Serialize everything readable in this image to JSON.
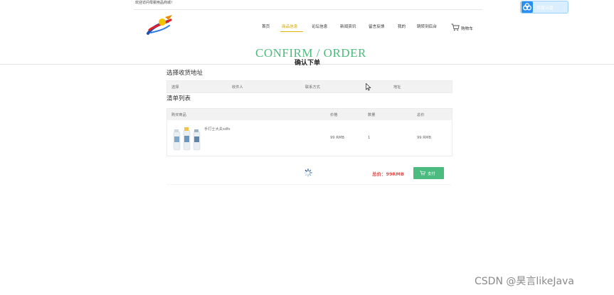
{
  "topbar": {
    "welcome": "欢迎访问母婴用品商城！"
  },
  "cloud_button": {
    "label": "百度云盘",
    "icon": "cloud-icon"
  },
  "nav": {
    "items": [
      {
        "label": "首页"
      },
      {
        "label": "商品信息",
        "active": true
      },
      {
        "label": "论坛信息"
      },
      {
        "label": "新闻资讯"
      },
      {
        "label": "留言反馈"
      },
      {
        "label": "我的"
      },
      {
        "label": "跳转到后台"
      }
    ],
    "cart_label": "购物车",
    "active_color": "#d6a500"
  },
  "hero": {
    "title": "CONFIRM / ORDER",
    "subtitle": "确认下单",
    "title_color": "#4dbb7b"
  },
  "address_section": {
    "title": "选择收货地址",
    "columns": [
      "选择",
      "收件人",
      "联系方式",
      "地址"
    ]
  },
  "order_list": {
    "title": "清单列表",
    "columns": [
      "购买商品",
      "价格",
      "数量",
      "总价"
    ],
    "rows": [
      {
        "product": "手打士大夫sdfs",
        "price": "99 RMB",
        "quantity": "1",
        "total": "99 RMB"
      }
    ]
  },
  "summary": {
    "total_label": "总价：99RMB",
    "pay_label": "支付",
    "pay_color": "#4cbb7f"
  },
  "watermark": "CSDN @昊言likeJava"
}
